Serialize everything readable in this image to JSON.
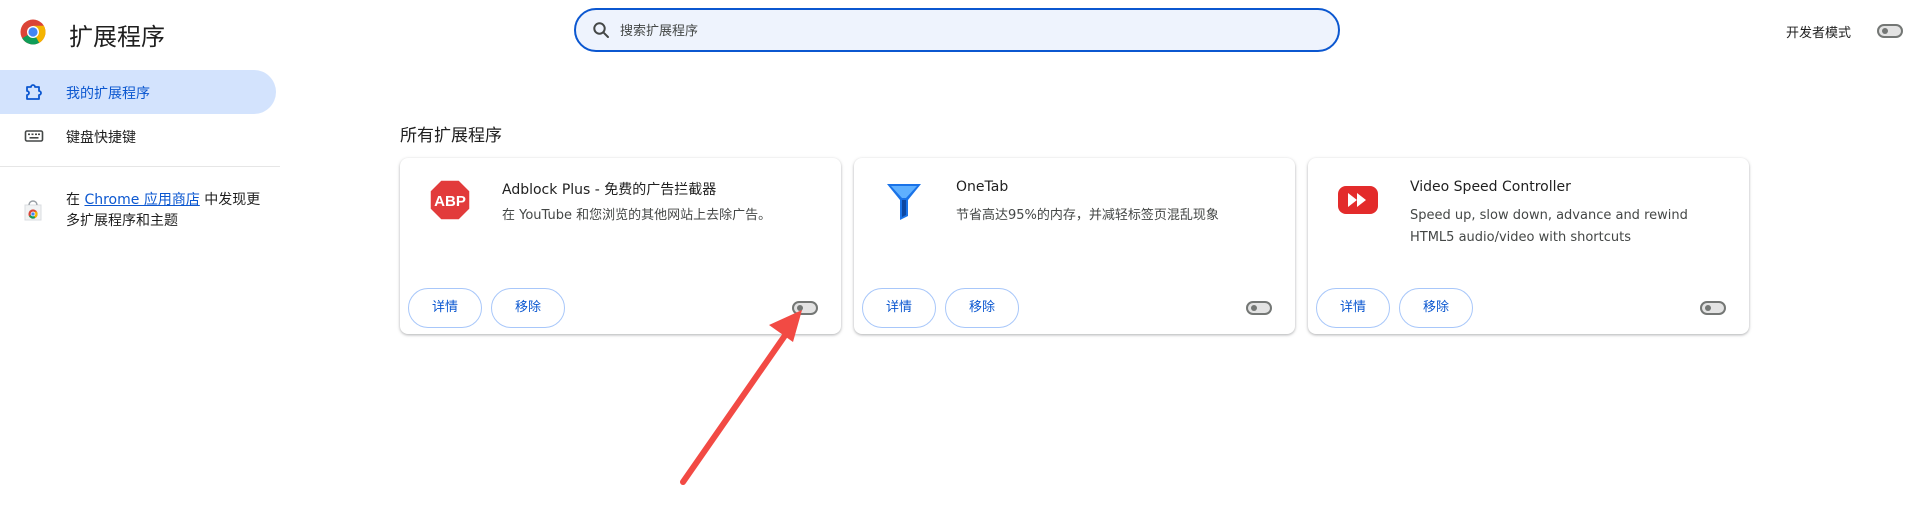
{
  "header": {
    "title": "扩展程序",
    "search_placeholder": "搜索扩展程序",
    "dev_mode_label": "开发者模式",
    "dev_mode_enabled": false
  },
  "sidebar": {
    "items": [
      {
        "label": "我的扩展程序",
        "active": true
      },
      {
        "label": "键盘快捷键",
        "active": false
      }
    ],
    "store_promo": {
      "prefix": "在 ",
      "link": "Chrome 应用商店",
      "suffix": " 中发现更多扩展程序和主题"
    }
  },
  "main": {
    "section_title": "所有扩展程序",
    "extensions": [
      {
        "name": "Adblock Plus - 免费的广告拦截器",
        "description": "在 YouTube 和您浏览的其他网站上去除广告。",
        "icon": "abp-stop-sign-icon",
        "details_label": "详情",
        "remove_label": "移除",
        "enabled": false
      },
      {
        "name": "OneTab",
        "description": "节省高达95%的内存，并减轻标签页混乱现象",
        "icon": "onetab-funnel-icon",
        "details_label": "详情",
        "remove_label": "移除",
        "enabled": false
      },
      {
        "name": "Video Speed Controller",
        "description": "Speed up, slow down, advance and rewind HTML5 audio/video with shortcuts",
        "icon": "video-speed-controller-icon",
        "details_label": "详情",
        "remove_label": "移除",
        "enabled": false
      }
    ]
  },
  "colors": {
    "accent": "#0b57d0",
    "sidebar_active_bg": "#d3e3fd",
    "search_bg": "#eef3fd",
    "annotation_arrow": "#f24a44"
  }
}
